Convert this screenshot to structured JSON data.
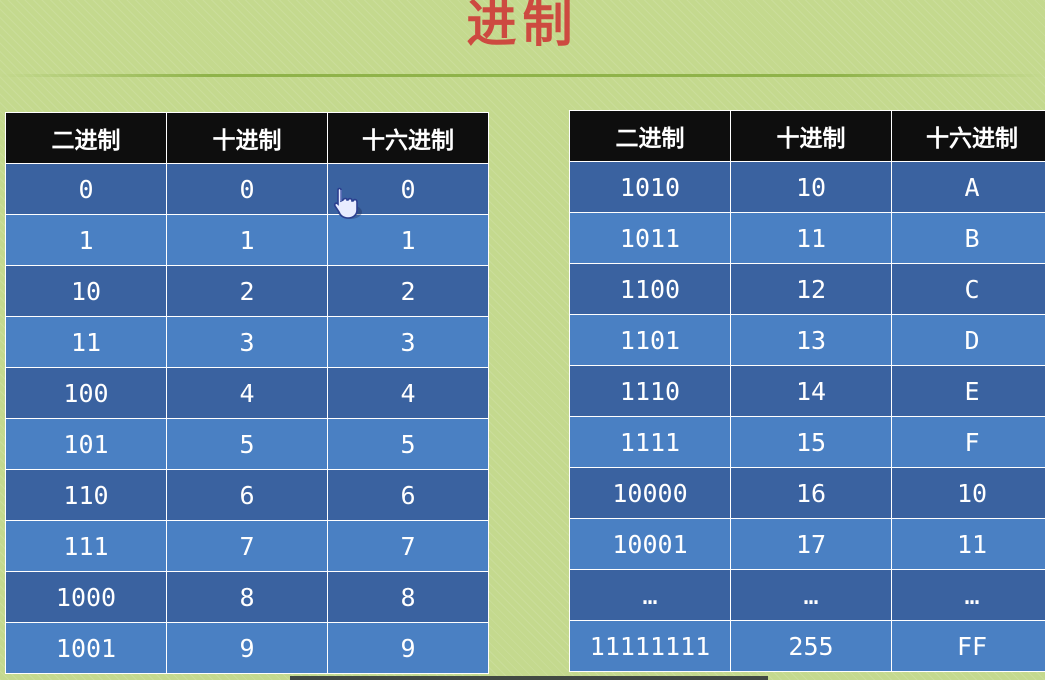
{
  "title": "进制",
  "left_table": {
    "headers": [
      "二进制",
      "十进制",
      "十六进制"
    ],
    "rows": [
      [
        "0",
        "0",
        "0"
      ],
      [
        "1",
        "1",
        "1"
      ],
      [
        "10",
        "2",
        "2"
      ],
      [
        "11",
        "3",
        "3"
      ],
      [
        "100",
        "4",
        "4"
      ],
      [
        "101",
        "5",
        "5"
      ],
      [
        "110",
        "6",
        "6"
      ],
      [
        "111",
        "7",
        "7"
      ],
      [
        "1000",
        "8",
        "8"
      ],
      [
        "1001",
        "9",
        "9"
      ]
    ]
  },
  "right_table": {
    "headers": [
      "二进制",
      "十进制",
      "十六进制"
    ],
    "rows": [
      [
        "1010",
        "10",
        "A"
      ],
      [
        "1011",
        "11",
        "B"
      ],
      [
        "1100",
        "12",
        "C"
      ],
      [
        "1101",
        "13",
        "D"
      ],
      [
        "1110",
        "14",
        "E"
      ],
      [
        "1111",
        "15",
        "F"
      ],
      [
        "10000",
        "16",
        "10"
      ],
      [
        "10001",
        "17",
        "11"
      ],
      [
        "…",
        "…",
        "…"
      ],
      [
        "11111111",
        "255",
        "FF"
      ]
    ]
  },
  "cursor": "pointing-hand-icon",
  "colors": {
    "background": "#c4d98e",
    "title": "#cd4a40",
    "header_bg": "#0e0e0e",
    "row_dark": "#3a62a0",
    "row_light": "#4a80c3",
    "cell_text": "#ffffff"
  }
}
